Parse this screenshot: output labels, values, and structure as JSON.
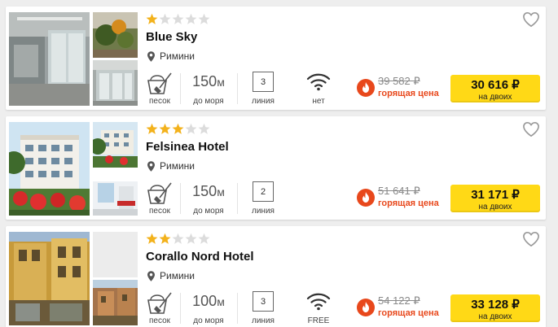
{
  "colors": {
    "star_filled": "#f3b21c",
    "star_empty": "#dcdcdc",
    "hot": "#e8481c",
    "button": "#ffd916"
  },
  "icons": {
    "stars": "star-icon",
    "location": "location-pin-icon",
    "favorite": "heart-icon",
    "beach": "sand-bucket-icon",
    "wifi": "wifi-icon",
    "hot": "fire-icon"
  },
  "hotels": [
    {
      "name": "Blue Sky",
      "stars": 1,
      "location": "Римини",
      "beach_label": "песок",
      "distance_value": "150",
      "distance_unit": "м",
      "distance_label": "до моря",
      "line_value": "3",
      "line_label": "линия",
      "wifi_label": "нет",
      "old_price": "39 582 ₽",
      "hot_label": "горящая цена",
      "price": "30 616 ₽",
      "price_note": "на двоих"
    },
    {
      "name": "Felsinea Hotel",
      "stars": 3,
      "location": "Римини",
      "beach_label": "песок",
      "distance_value": "150",
      "distance_unit": "м",
      "distance_label": "до моря",
      "line_value": "2",
      "line_label": "линия",
      "old_price": "51 641 ₽",
      "hot_label": "горящая цена",
      "price": "31 171 ₽",
      "price_note": "на двоих"
    },
    {
      "name": "Corallo Nord Hotel",
      "stars": 2,
      "location": "Римини",
      "beach_label": "песок",
      "distance_value": "100",
      "distance_unit": "м",
      "distance_label": "до моря",
      "line_value": "3",
      "line_label": "линия",
      "wifi_label": "FREE",
      "old_price": "54 122 ₽",
      "hot_label": "горящая цена",
      "price": "33 128 ₽",
      "price_note": "на двоих"
    }
  ]
}
